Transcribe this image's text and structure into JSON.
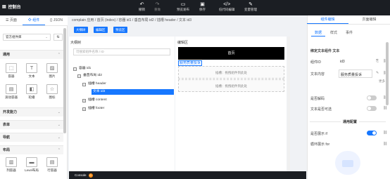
{
  "topbar": {
    "title": "控制台",
    "buttons": [
      {
        "icon": "undo-icon",
        "glyph": "↶",
        "label": "撤销"
      },
      {
        "icon": "redo-icon",
        "glyph": "↷",
        "label": "重做"
      },
      {
        "icon": "preview-icon",
        "glyph": "▭",
        "label": "预览发布"
      },
      {
        "icon": "save-icon",
        "glyph": "▣",
        "label": "保存"
      },
      {
        "icon": "code-edit-icon",
        "glyph": "</>",
        "label": "低代码编辑"
      },
      {
        "icon": "variable-icon",
        "glyph": "✎",
        "label": "变量管理"
      }
    ]
  },
  "left": {
    "tabs": [
      "页面",
      "组件",
      "JSON"
    ],
    "library_select": "官方组件库",
    "sort_icon": "sort-icon",
    "sections": {
      "common": "通用",
      "dev": "开发能力",
      "form": "表单",
      "nav": "导航",
      "layout": "布局"
    },
    "common_items": [
      {
        "label": "容器",
        "glyph": "⬚",
        "icon": "container-icon"
      },
      {
        "label": "文本",
        "glyph": "T",
        "icon": "text-icon"
      },
      {
        "label": "图片",
        "glyph": "▨",
        "icon": "image-icon"
      },
      {
        "label": "滚动容器",
        "glyph": "▤",
        "icon": "scroll-container-icon"
      },
      {
        "label": "轮播",
        "glyph": "◧",
        "icon": "carousel-icon"
      },
      {
        "label": "图标",
        "glyph": "☆",
        "icon": "star-icon"
      }
    ],
    "layout_items": [
      {
        "label": "列容器",
        "glyph": "▥",
        "icon": "column-container-icon"
      },
      {
        "label": "Level布局",
        "glyph": "▬",
        "icon": "level-layout-icon"
      },
      {
        "label": "行容器",
        "glyph": "▤",
        "icon": "row-container-icon"
      }
    ]
  },
  "breadcrumb": "complain 应用 / 首页 (index) / 容器 id1 / 垂直布局 id2 / 插槽 header / 文本 id3",
  "action_buttons": [
    "大纲树",
    "编辑区",
    "预览区"
  ],
  "tree": {
    "label": "大纲树",
    "search_placeholder": "可搜索组件名称 / ID",
    "nodes": [
      {
        "text": "容器 id1",
        "indent": 0,
        "selected": false
      },
      {
        "text": "垂直布局 id2",
        "indent": 1,
        "selected": false
      },
      {
        "text": "插槽 header",
        "indent": 2,
        "selected": false
      },
      {
        "text": "文本 id3",
        "indent": 3,
        "selected": true
      },
      {
        "text": "插槽 content",
        "indent": 2,
        "selected": false
      },
      {
        "text": "插槽 footer",
        "indent": 2,
        "selected": false
      }
    ]
  },
  "canvas": {
    "label": "编辑区",
    "page_title": "首页",
    "selected_text": "服务质量投诉",
    "slot_text": "插槽：拖拽组件到此处"
  },
  "statusbar": {
    "label": "Console",
    "badge": "0"
  },
  "right": {
    "tabs": [
      "组件编辑",
      "页面编辑"
    ],
    "subtabs": [
      "数据",
      "样式",
      "事件"
    ],
    "section_title": "绑定文本组件 文本",
    "component_id_label": "组件ID",
    "component_id": "id3",
    "content_label": "文本内容",
    "content_value": "服务质量投诉",
    "more": "更多",
    "escape_label": "是否解码",
    "selectable_label": "文本是否可选",
    "generic_section": "通用配置",
    "show_label": "是否展示 if",
    "loop_label": "循环展示 for",
    "colors": {
      "accent": "#1677ff",
      "dark": "#1b1e23"
    }
  }
}
